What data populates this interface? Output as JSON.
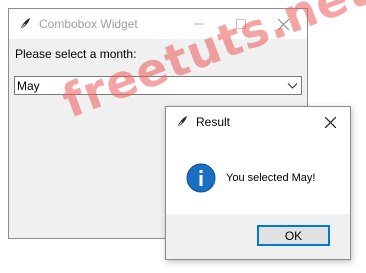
{
  "main_window": {
    "title": "Combobox Widget",
    "prompt": "Please select a month:",
    "combobox": {
      "value": "May"
    },
    "icons": {
      "app": "feather-icon",
      "minimize": "minimize-icon",
      "maximize": "maximize-icon",
      "close": "close-icon",
      "dropdown": "chevron-down-icon"
    }
  },
  "dialog": {
    "title": "Result",
    "message": "You selected May!",
    "ok_label": "OK",
    "icons": {
      "app": "feather-icon",
      "info": "info-icon",
      "close": "close-icon"
    }
  },
  "watermark": "freetuts.net",
  "colors": {
    "accent": "#0078d7",
    "info_icon": "#1b6fc2",
    "watermark": "#ec5a5a"
  }
}
